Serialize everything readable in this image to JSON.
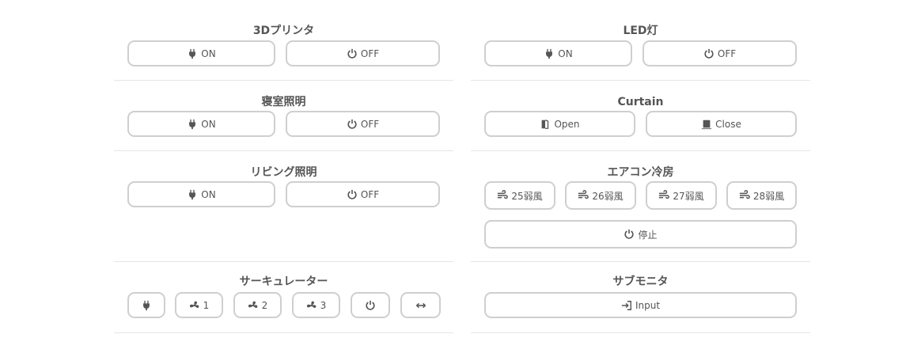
{
  "left": {
    "printer": {
      "title": "3Dプリンタ",
      "on": "ON",
      "off": "OFF"
    },
    "bedroom": {
      "title": "寝室照明",
      "on": "ON",
      "off": "OFF"
    },
    "living": {
      "title": "リビング照明",
      "on": "ON",
      "off": "OFF"
    },
    "circulator": {
      "title": "サーキュレーター",
      "speed1": "1",
      "speed2": "2",
      "speed3": "3"
    }
  },
  "right": {
    "led": {
      "title": "LED灯",
      "on": "ON",
      "off": "OFF"
    },
    "curtain": {
      "title": "Curtain",
      "open": "Open",
      "close": "Close"
    },
    "aircon": {
      "title": "エアコン冷房",
      "t25": "25弱風",
      "t26": "26弱風",
      "t27": "27弱風",
      "t28": "28弱風",
      "stop": "停止"
    },
    "submonitor": {
      "title": "サブモニタ",
      "input": "Input"
    }
  },
  "icons": {
    "plug": "plug-icon",
    "power": "power-icon",
    "fan": "fan-icon",
    "wind": "wind-icon",
    "door-open": "door-open-icon",
    "door-closed": "door-closed-icon",
    "swap": "swap-icon",
    "input": "sign-in-icon"
  },
  "colors": {
    "text": "#555555",
    "border": "#cfcfcf",
    "divider": "#e6e6e6",
    "background": "#ffffff"
  }
}
